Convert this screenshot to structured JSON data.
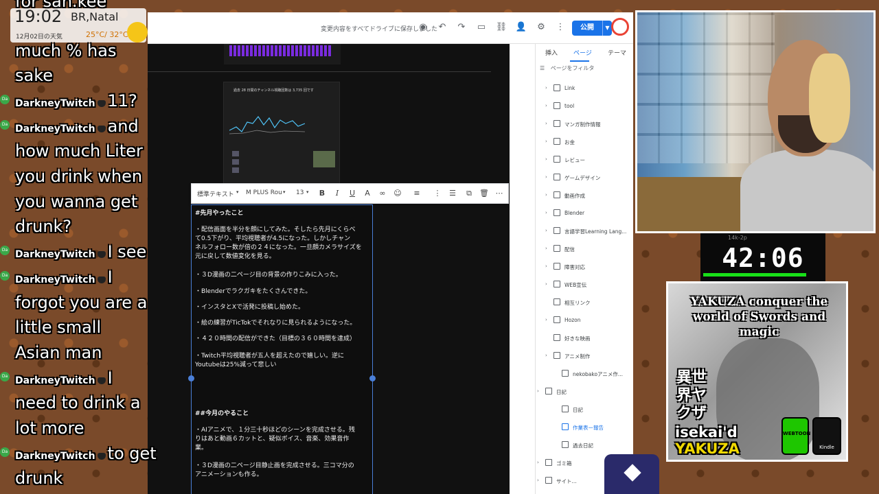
{
  "editor": {
    "save_status": "変更内容をすべてドライブに保存しました",
    "publish_label": "公開",
    "toolbar_icons": [
      "preview-icon",
      "undo-icon",
      "redo-icon",
      "device-preview-icon",
      "link-icon",
      "add-person-icon",
      "settings-icon",
      "more-icon"
    ]
  },
  "canvas": {
    "analytics_title": "過去 28 日間のチャンネル視聴回数は 3,735 回です"
  },
  "format_toolbar": {
    "style": "標準テキスト",
    "font": "M PLUS Rou",
    "size": "13"
  },
  "textbox": {
    "lines": [
      "#先月やったこと",
      "・配信画面を半分を顔にしてみた。そしたら先月にくらべ",
      "て0.5下がり、平均視聴者が4.5になった。しかしチャン",
      "ネルフォロー数が倍の２４になった。一旦顔カメラサイズを",
      "元に戻して数値変化を見る。",
      "・３D漫画の二ページ目の背景の作りこみに入った。",
      "・Blenderでラクガキをたくさんできた。",
      "・インスタとXで活発に投稿し始めた。",
      "・絵の練習がTicTokでそれなりに見られるようになった。",
      "・４２０時間の配信ができた（目標の３６０時間を達成）",
      "・Twitch平均視聴者が五人を超えたので嬉しい。逆に",
      "Youtubeは25%減って悲しい",
      "##今月のやること",
      "・AIアニメで、１分三十秒ほどのシーンを完成させる。残",
      "りはあと動画６カットと、疑似ボイス、音楽、効果音作",
      "業。",
      "・３D漫画の二ページ目静止画を完成させる。三コマ分の",
      "アニメーションも作る。"
    ]
  },
  "side_panel": {
    "tabs": [
      "挿入",
      "ページ",
      "テーマ"
    ],
    "filter_label": "ページをフィルタ",
    "pages": [
      {
        "label": "Link",
        "chevron": true
      },
      {
        "label": "tool",
        "chevron": true
      },
      {
        "label": "マンガ制作情報",
        "chevron": true
      },
      {
        "label": "お金",
        "chevron": true
      },
      {
        "label": "レビュー",
        "chevron": true
      },
      {
        "label": "ゲームデザイン",
        "chevron": true
      },
      {
        "label": "動画作成",
        "chevron": true
      },
      {
        "label": "Blender",
        "chevron": true
      },
      {
        "label": "言語学習Learning Lang...",
        "chevron": true
      },
      {
        "label": "配信",
        "chevron": true
      },
      {
        "label": "障害対応",
        "chevron": true
      },
      {
        "label": "WEB宣伝",
        "chevron": true
      },
      {
        "label": "相互リンク",
        "chevron": false
      },
      {
        "label": "Hozon",
        "chevron": true
      },
      {
        "label": "好きな映画",
        "chevron": false
      },
      {
        "label": "アニメ制作",
        "chevron": true
      },
      {
        "label": "nekobakoアニメ作...",
        "chevron": false
      },
      {
        "label": "日記",
        "chevron": true
      },
      {
        "label": "日記",
        "chevron": false
      },
      {
        "label": "作業表ー報告",
        "chevron": false,
        "active": true
      },
      {
        "label": "過去日記",
        "chevron": false
      },
      {
        "label": "ゴミ箱",
        "chevron": true
      },
      {
        "label": "サイト...",
        "chevron": true
      }
    ]
  },
  "clock": {
    "time": "19:02",
    "location": "BR,Natal",
    "date": "12月02日の天気",
    "temp": "25°C/ 32°C"
  },
  "chat": {
    "lines": [
      {
        "type": "text",
        "text": "for san.kee"
      },
      {
        "type": "text",
        "text": "much % has"
      },
      {
        "type": "text",
        "text": "sake"
      },
      {
        "type": "msg",
        "name": "DarkneyTwitch",
        "text": "11?"
      },
      {
        "type": "msg",
        "name": "DarkneyTwitch",
        "text": "and"
      },
      {
        "type": "text",
        "text": "how much Liter"
      },
      {
        "type": "text",
        "text": "you drink when"
      },
      {
        "type": "text",
        "text": "you wanna get"
      },
      {
        "type": "text",
        "text": "drunk?"
      },
      {
        "type": "msg",
        "name": "DarkneyTwitch",
        "text": "I see"
      },
      {
        "type": "msg",
        "name": "DarkneyTwitch",
        "text": "I"
      },
      {
        "type": "text",
        "text": "forgot you are a"
      },
      {
        "type": "text",
        "text": "little small"
      },
      {
        "type": "text",
        "text": "Asian man"
      },
      {
        "type": "msg",
        "name": "DarkneyTwitch",
        "text": "I"
      },
      {
        "type": "text",
        "text": "need to drink a"
      },
      {
        "type": "text",
        "text": "lot more"
      },
      {
        "type": "msg",
        "name": "DarkneyTwitch",
        "text": "to get"
      },
      {
        "type": "text",
        "text": "drunk"
      }
    ],
    "badge_label": "Da"
  },
  "timer": {
    "value": "42:06",
    "label": "14k-2p"
  },
  "book": {
    "title": "YAKUZA conquer the world of Swords and magic",
    "jp_title": "異世界ヤクザ",
    "subtitle_1": "isekai'd",
    "subtitle_2": "YAKUZA",
    "badge_webtoon": "WEBTOON",
    "badge_kindle": "Kindle"
  }
}
